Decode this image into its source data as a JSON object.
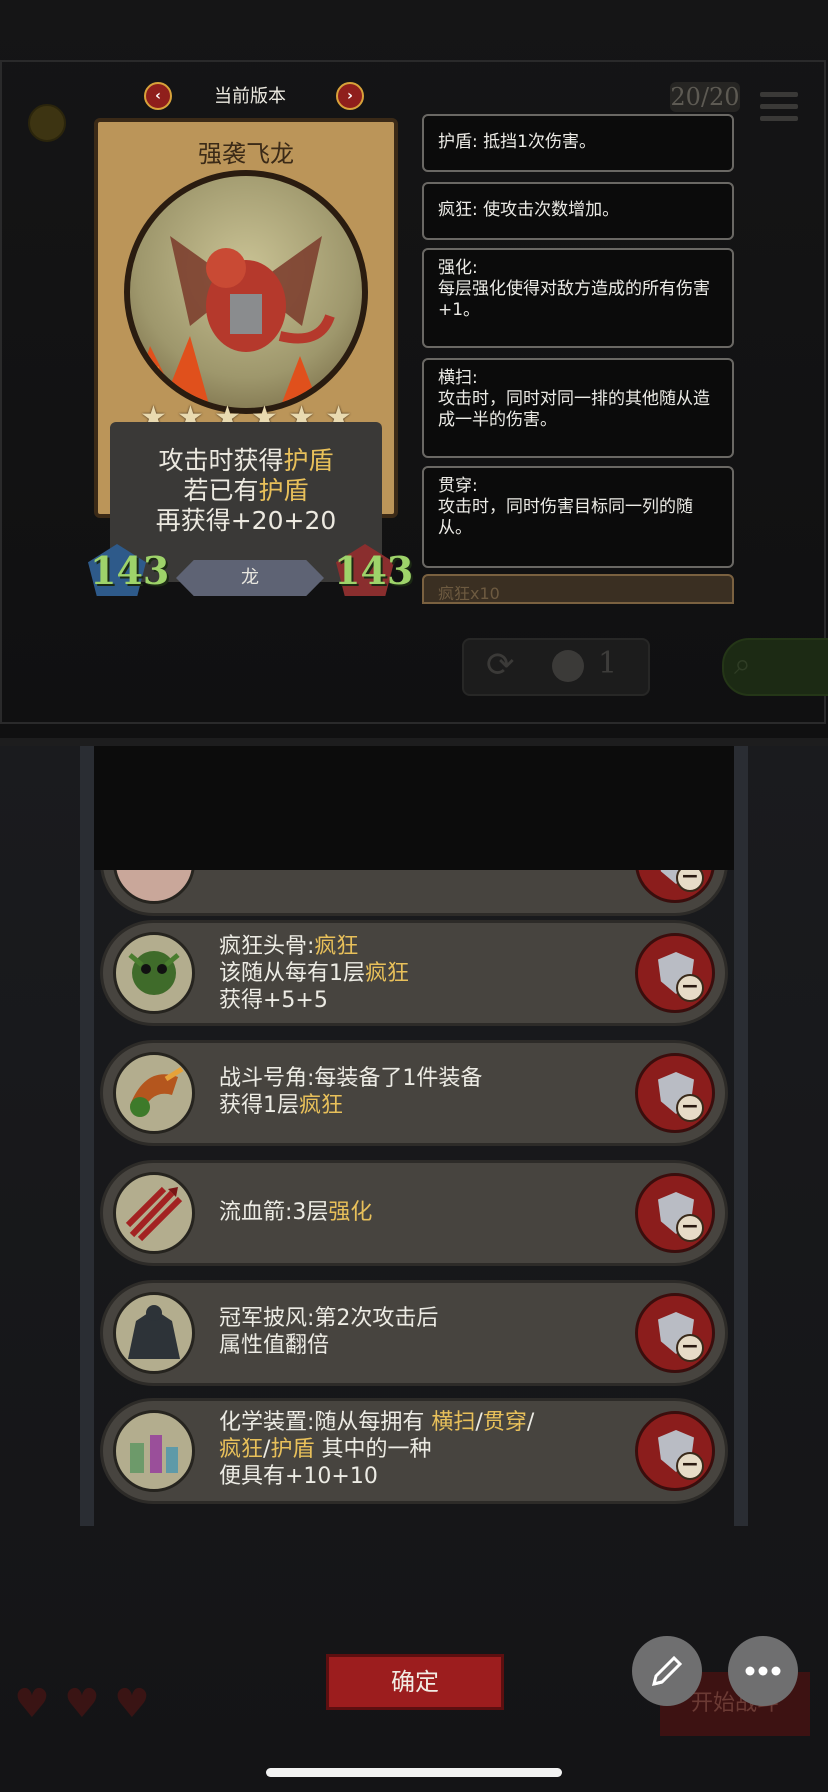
{
  "header": {
    "version_label": "当前版本",
    "prev_arrow": "‹",
    "next_arrow": "›",
    "counter": "20/20"
  },
  "card": {
    "name": "强袭飞龙",
    "stars": 6,
    "description": {
      "line1_pre": "攻击时获得",
      "line1_hl": "护盾",
      "line2_pre": "若已有",
      "line2_hl": "护盾",
      "line3": "再获得+20+20"
    },
    "attack": "143",
    "health": "143",
    "tribe": "龙"
  },
  "keywords": [
    {
      "title": "护盾: 抵挡1次伤害。",
      "body": ""
    },
    {
      "title": "疯狂: 使攻击次数增加。",
      "body": ""
    },
    {
      "title": "强化:",
      "body": "每层强化使得对敌方造成的所有伤害+1。"
    },
    {
      "title": "横扫:",
      "body": "攻击时，同时对同一排的其他随从造成一半的伤害。"
    },
    {
      "title": "贯穿:",
      "body": "攻击时，同时伤害目标同一列的随从。"
    }
  ],
  "keyword_peek": "疯狂x10",
  "refresh": {
    "count": "1"
  },
  "equipment": [
    {
      "lines": [
        [
          {
            "t": "疯狂头骨:"
          },
          {
            "t": "疯狂",
            "hl": true
          }
        ],
        [
          {
            "t": "该随从每有1层"
          },
          {
            "t": "疯狂",
            "hl": true
          }
        ],
        [
          {
            "t": "获得+5+5"
          }
        ]
      ],
      "icon": "skull-icon",
      "icon_color": "#3f6b2a"
    },
    {
      "lines": [
        [
          {
            "t": "战斗号角:每装备了1件装备"
          }
        ],
        [
          {
            "t": "获得1层"
          },
          {
            "t": "疯狂",
            "hl": true
          }
        ]
      ],
      "icon": "horn-icon",
      "icon_color": "#b4561e"
    },
    {
      "lines": [
        [
          {
            "t": "流血箭:3层"
          },
          {
            "t": "强化",
            "hl": true
          }
        ]
      ],
      "icon": "arrow-icon",
      "icon_color": "#a32222"
    },
    {
      "lines": [
        [
          {
            "t": "冠军披风:第2次攻击后"
          }
        ],
        [
          {
            "t": "属性值翻倍"
          }
        ]
      ],
      "icon": "cloak-icon",
      "icon_color": "#2d3338"
    },
    {
      "lines": [
        [
          {
            "t": "化学装置:随从每拥有 "
          },
          {
            "t": "横扫",
            "hl": true
          },
          {
            "t": "/"
          },
          {
            "t": "贯穿",
            "hl": true
          },
          {
            "t": "/"
          }
        ],
        [
          {
            "t": "疯狂",
            "hl": true
          },
          {
            "t": "/"
          },
          {
            "t": "护盾",
            "hl": true
          },
          {
            "t": " 其中的一种"
          }
        ],
        [
          {
            "t": "便具有+10+10"
          }
        ]
      ],
      "icon": "flask-icon",
      "icon_color": "#6d9a6a"
    }
  ],
  "buttons": {
    "confirm": "确定",
    "start": "开始战斗"
  },
  "colors": {
    "highlight": "#e8c05a",
    "stat_green": "#9ed36a",
    "confirm_red": "#9c1d1e"
  }
}
